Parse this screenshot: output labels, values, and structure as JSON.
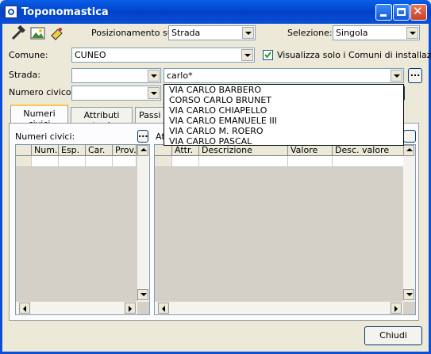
{
  "window": {
    "title": "Toponomastica"
  },
  "positioning": {
    "label": "Posizionamento su:",
    "value": "Strada"
  },
  "selection": {
    "label": "Selezione:",
    "value": "Singola"
  },
  "comune": {
    "label": "Comune:",
    "value": "CUNEO",
    "checkbox_label": "Visualizza solo i Comuni di installazione",
    "checked": true
  },
  "strada": {
    "label": "Strada:",
    "search_value": "carlo*",
    "more_label": "..."
  },
  "numero": {
    "label": "Numero civico:"
  },
  "tabs": [
    {
      "label": "Numeri civici"
    },
    {
      "label": "Attributi strada"
    },
    {
      "label": "Passi c"
    }
  ],
  "left_grid": {
    "title": "Numeri civici:",
    "more_label": "...",
    "columns": [
      "Num.",
      "Esp.",
      "Car.",
      "Prov."
    ]
  },
  "right_grid": {
    "title": "Attr",
    "columns": [
      "Attr.",
      "Descrizione",
      "Valore",
      "Desc. valore"
    ]
  },
  "dropdown": {
    "items": [
      "VIA CARLO BARBERO",
      "CORSO CARLO BRUNET",
      "VIA CARLO CHIAPELLO",
      "VIA CARLO EMANUELE III",
      "VIA CARLO M. ROERO",
      "VIA CARLO PASCAL"
    ]
  },
  "footer": {
    "close_label": "Chiudi"
  }
}
